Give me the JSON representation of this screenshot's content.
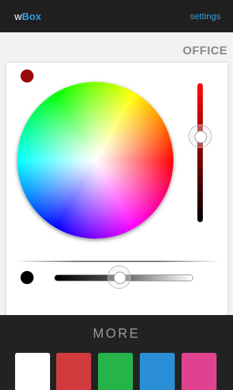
{
  "app": {
    "brand_prefix": "w",
    "brand_suffix": "Box",
    "settings_label": "settings"
  },
  "room": {
    "title": "OFFICE"
  },
  "color": {
    "current": "#9b0a0a",
    "brightness_level": 0.35,
    "white_dot": "#000000",
    "white_level": 0.47
  },
  "more": {
    "label": "MORE",
    "presets": [
      {
        "name": "white",
        "color": "#ffffff"
      },
      {
        "name": "red",
        "color": "#d13b3e"
      },
      {
        "name": "green",
        "color": "#25b34a"
      },
      {
        "name": "blue",
        "color": "#2a8fd6"
      },
      {
        "name": "pink",
        "color": "#df4390"
      }
    ]
  }
}
